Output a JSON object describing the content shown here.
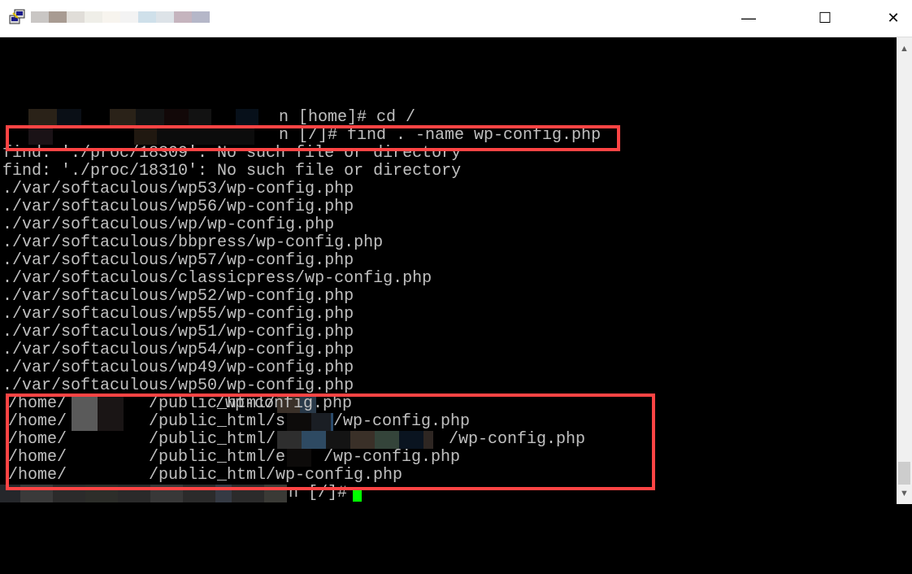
{
  "window": {
    "title_obscured": true,
    "controls": {
      "minimize": "—",
      "maximize": "☐",
      "close": "✕"
    }
  },
  "terminal": {
    "text_color": "#c0c0c0",
    "highlight_color": "#ff4444",
    "cursor_color": "#00ff00",
    "prompt1": "n [home]# cd /",
    "prompt2": "n [/]# find . -name wp-config.php",
    "errors": [
      "find: './proc/18309': No such file or directory",
      "find: './proc/18310': No such file or directory"
    ],
    "results": [
      "./var/softaculous/wp53/wp-config.php",
      "./var/softaculous/wp56/wp-config.php",
      "./var/softaculous/wp/wp-config.php",
      "./var/softaculous/bbpress/wp-config.php",
      "./var/softaculous/wp57/wp-config.php",
      "./var/softaculous/classicpress/wp-config.php",
      "./var/softaculous/wp52/wp-config.php",
      "./var/softaculous/wp55/wp-config.php",
      "./var/softaculous/wp51/wp-config.php",
      "./var/softaculous/wp54/wp-config.php",
      "./var/softaculous/wp49/wp-config.php",
      "./var/softaculous/wp50/wp-config.php"
    ],
    "home_prefix": "/home/",
    "home_results": [
      {
        "mid": "/public_html/",
        "tail": "/wp-config.php"
      },
      {
        "mid": "/public_html/s",
        "tail": "/wp-config.php"
      },
      {
        "mid": "/public_html/",
        "tail": "/wp-config.php"
      },
      {
        "mid": "/public_html/e",
        "tail": "/wp-config.php"
      },
      {
        "mid": "/public_html/wp-config.php",
        "tail": ""
      }
    ],
    "final_prompt": "n [/]#"
  }
}
